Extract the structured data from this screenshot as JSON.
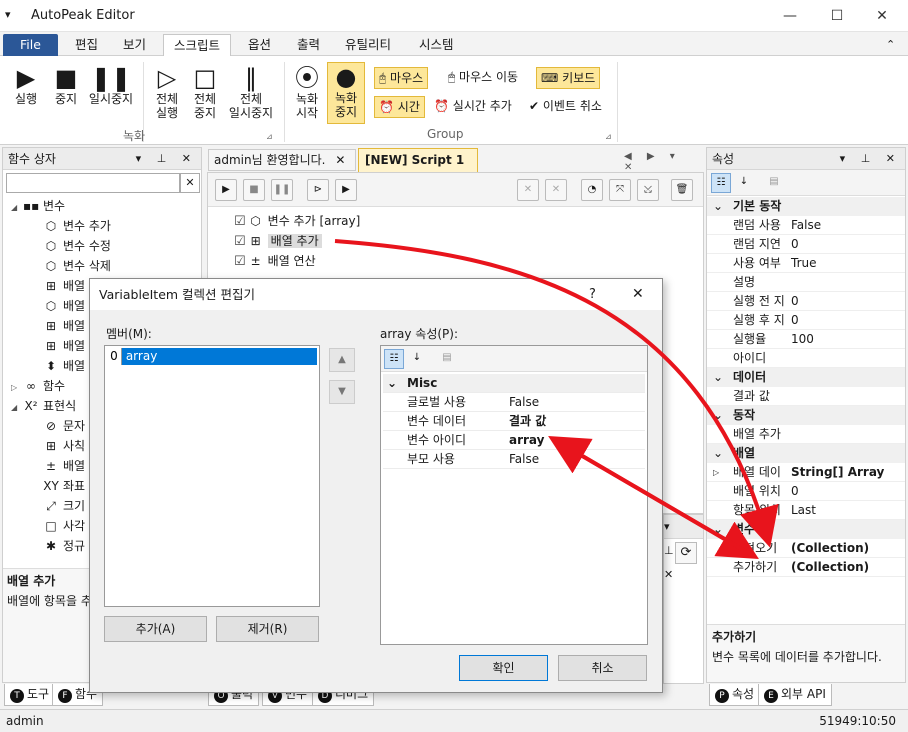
{
  "window": {
    "title": "AutoPeak Editor",
    "app_icon": "▾",
    "min": "—",
    "max": "☐",
    "close": "✕"
  },
  "menu": {
    "tabs": [
      "File",
      "편집",
      "보기",
      "스크립트",
      "옵션",
      "출력",
      "유틸리티",
      "시스템"
    ],
    "collapse": "⌃"
  },
  "ribbon": {
    "record_group": "녹화",
    "record_group_mark": "⊿",
    "buttons": [
      {
        "label": "실행",
        "icon": "▶"
      },
      {
        "label": "중지",
        "icon": "■"
      },
      {
        "label": "일시중지",
        "icon": "❚❚"
      },
      {
        "label": "전체\n실행",
        "icon": "▷"
      },
      {
        "label": "전체\n중지",
        "icon": "□"
      },
      {
        "label": "전체\n일시중지",
        "icon": "‖"
      }
    ],
    "record_start": "녹화\n시작",
    "record_stop": "녹화\n중지",
    "group_label": "Group",
    "group_mark": "⊿",
    "mouse": "마우스",
    "mouse_move": "마우스 이동",
    "keyboard": "키보드",
    "time": "시간",
    "realtime_add": "실시간 추가",
    "event_cancel": "이벤트 취소"
  },
  "func_box": {
    "title": "함수 상자",
    "controls": "▾ ⊥ ✕",
    "search_clear": "✕",
    "items": [
      {
        "label": "변수",
        "icon": "▪▪",
        "expander": "◢",
        "level": 0
      },
      {
        "label": "변수 추가",
        "icon": "⬡",
        "level": 1
      },
      {
        "label": "변수 수정",
        "icon": "⬡",
        "level": 1
      },
      {
        "label": "변수 삭제",
        "icon": "⬡",
        "level": 1
      },
      {
        "label": "배열",
        "icon": "⊞",
        "level": 1
      },
      {
        "label": "배열",
        "icon": "⬡",
        "level": 1
      },
      {
        "label": "배열",
        "icon": "⊞",
        "level": 1
      },
      {
        "label": "배열",
        "icon": "⊞",
        "level": 1
      },
      {
        "label": "배열",
        "icon": "⬍",
        "level": 1
      },
      {
        "label": "함수",
        "icon": "∞",
        "expander": "▷",
        "level": 0
      },
      {
        "label": "표현식",
        "icon": "X²",
        "expander": "◢",
        "level": 0
      },
      {
        "label": "문자",
        "icon": "⊘",
        "level": 1
      },
      {
        "label": "사칙",
        "icon": "⊞",
        "level": 1
      },
      {
        "label": "배열",
        "icon": "±",
        "level": 1
      },
      {
        "label": "좌표",
        "icon": "XY",
        "level": 1
      },
      {
        "label": "크기",
        "icon": "⤢",
        "level": 1
      },
      {
        "label": "사각",
        "icon": "□",
        "level": 1
      },
      {
        "label": "정규",
        "icon": "✱",
        "level": 1
      }
    ],
    "desc_title": "배열 추가",
    "desc_text": "배열에 항목을 추"
  },
  "doc_tabs": {
    "tab1": "admin님 환영합니다.",
    "tab2": "[NEW] Script 1",
    "close1": "✕",
    "controls": "◀ ▶ ▾ ✕"
  },
  "script_toolbar": {
    "play": "▶",
    "stop": "■",
    "pause": "❚❚",
    "play_frame": "⊳",
    "play_all": "▶",
    "close_a": "✕",
    "close_b": "✕",
    "zoom": "◔",
    "expand": "⤧",
    "shrink": "⤩",
    "delete": "🗑"
  },
  "script_lines": [
    {
      "text": "변수 추가 [array]",
      "icon": "⬡"
    },
    {
      "text": "배열 추가",
      "icon": "⊞"
    },
    {
      "text": "배열 연산",
      "icon": "±"
    }
  ],
  "dialog": {
    "title": "VariableItem 컬렉션 편집기",
    "help": "?",
    "close": "✕",
    "members_label": "멤버(M):",
    "members": [
      {
        "index": "0",
        "name": "array"
      }
    ],
    "up": "▲",
    "down": "▼",
    "props_label": "array 속성(P):",
    "category": "Misc",
    "category_toggle": "⌄",
    "props": [
      {
        "key": "글로벌 사용",
        "value": "False",
        "bold": false
      },
      {
        "key": "변수 데이터",
        "value": "결과 값",
        "bold": true
      },
      {
        "key": "변수 아이디",
        "value": "array",
        "bold": true
      },
      {
        "key": "부모 사용",
        "value": "False",
        "bold": false
      }
    ],
    "add": "추가(A)",
    "remove": "제거(R)",
    "ok": "확인",
    "cancel": "취소",
    "refresh": "⟳"
  },
  "properties": {
    "title": "속성",
    "controls": "▾ ⊥ ✕",
    "rows": [
      {
        "cat": "기본 동작"
      },
      {
        "key": "랜덤 사용",
        "value": "False"
      },
      {
        "key": "랜덤 지연",
        "value": "0"
      },
      {
        "key": "사용 여부",
        "value": "True"
      },
      {
        "key": "설명",
        "value": ""
      },
      {
        "key": "실행 전 지",
        "value": "0"
      },
      {
        "key": "실행 후 지",
        "value": "0"
      },
      {
        "key": "실행율",
        "value": "100"
      },
      {
        "key": "아이디",
        "value": ""
      },
      {
        "cat": "데이터"
      },
      {
        "key": "결과 값",
        "value": ""
      },
      {
        "cat": "동작"
      },
      {
        "key": "배열 추가",
        "value": ""
      },
      {
        "cat": "배열"
      },
      {
        "key": "배열 데이",
        "value": "String[] Array",
        "bold": true,
        "expander": "▷"
      },
      {
        "key": "배열 위치",
        "value": "0"
      },
      {
        "key": "항목 위치",
        "value": "Last"
      },
      {
        "cat": "변수"
      },
      {
        "key": "가져오기",
        "value": "(Collection)",
        "bold": true
      },
      {
        "key": "추가하기",
        "value": "(Collection)",
        "bold": true
      }
    ],
    "desc_title": "추가하기",
    "desc_text": "변수 목록에 데이터를 추가합니다."
  },
  "bottom_tabs": {
    "left1": "도구",
    "left1_icon": "T",
    "left2": "함수",
    "left2_icon": "F",
    "mid1": "출력",
    "mid2": "변수",
    "mid3": "디버그",
    "right1": "속성",
    "right1_icon": "P",
    "right2": "외부 API",
    "right2_icon": "E"
  },
  "status": {
    "user": "admin",
    "time": "51949:10:50"
  },
  "colors": {
    "accent": "#2b5797",
    "highlight": "#fde79a",
    "arrow": "#e8141c"
  }
}
